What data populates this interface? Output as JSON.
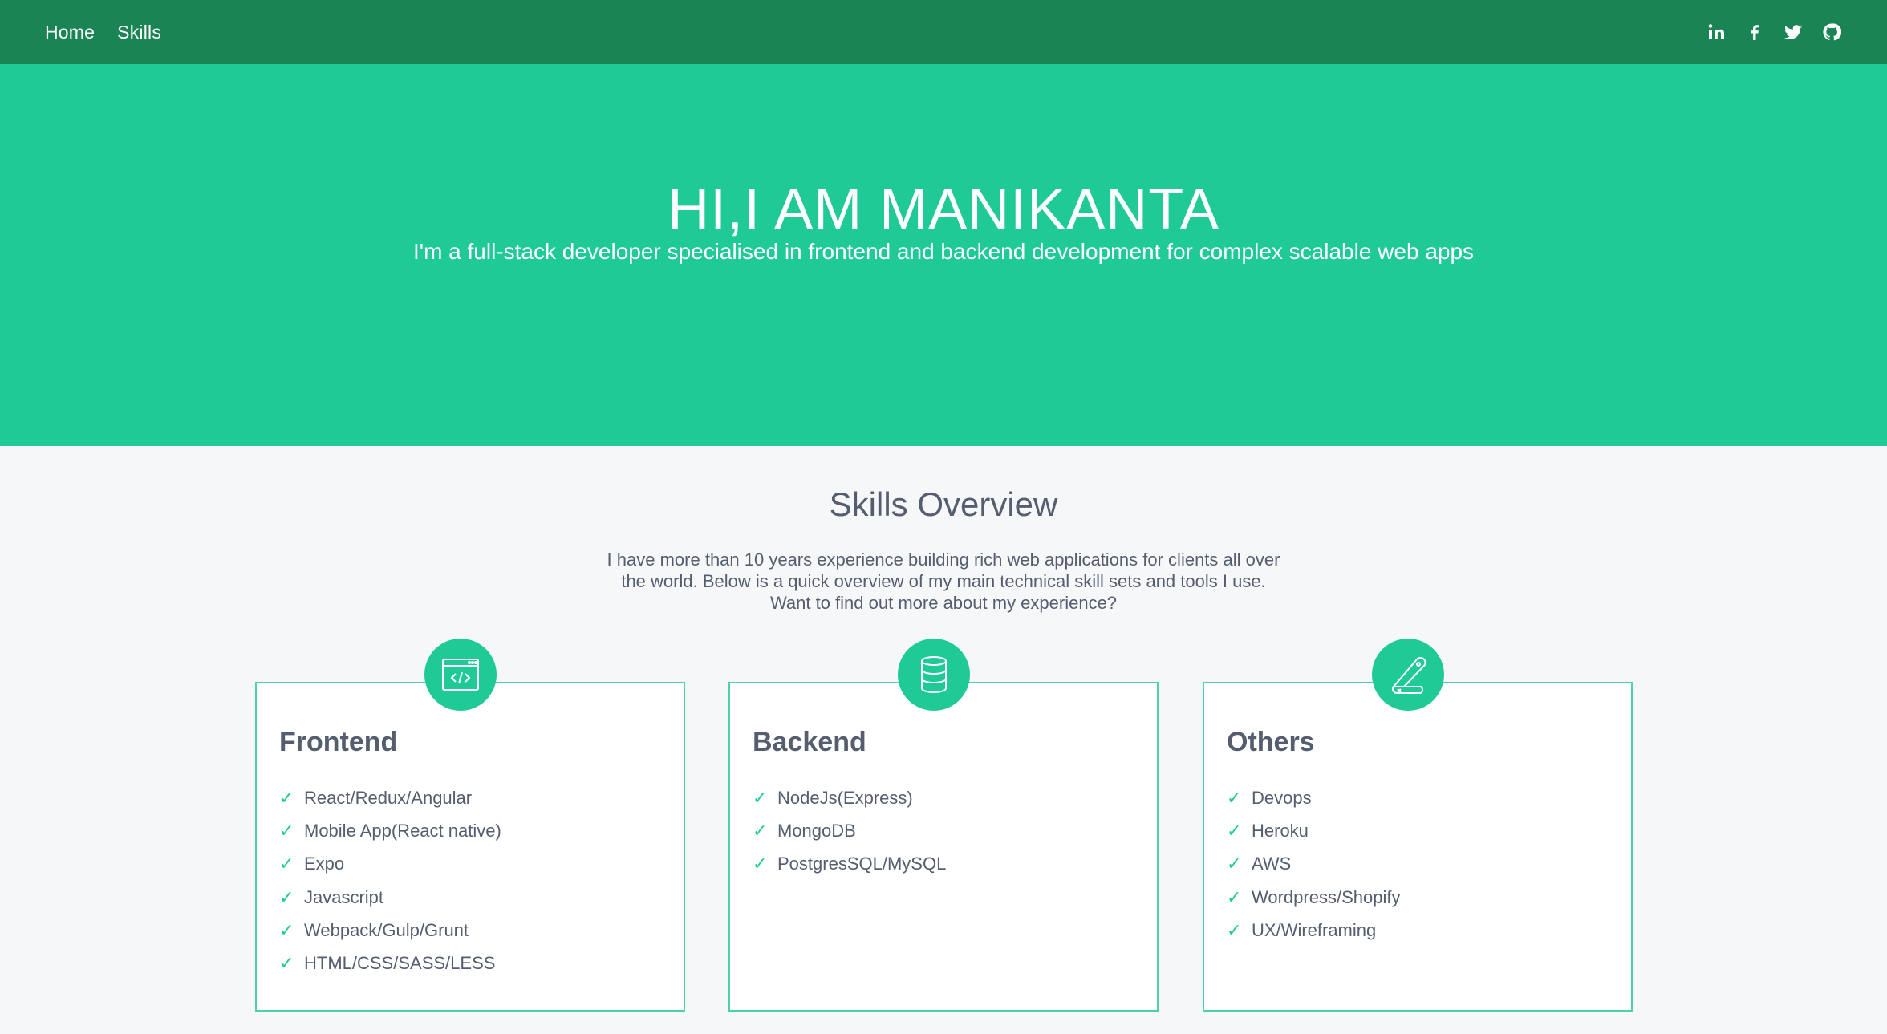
{
  "nav": {
    "links": [
      "Home",
      "Skills"
    ],
    "social": [
      "linkedin-icon",
      "facebook-icon",
      "twitter-icon",
      "github-icon"
    ]
  },
  "hero": {
    "title": "HI,I AM MANIKANTA",
    "subtitle": "I'm a full-stack developer specialised in frontend and backend development for complex scalable web apps"
  },
  "skills": {
    "title": "Skills Overview",
    "intro": "I have more than 10 years experience building rich web applications for clients all over the world. Below is a quick overview of my main technical skill sets and tools I use. Want to find out more about my experience?",
    "cards": [
      {
        "title": "Frontend",
        "icon": "code-window-icon",
        "items": [
          "React/Redux/Angular",
          "Mobile App(React native)",
          "Expo",
          "Javascript",
          "Webpack/Gulp/Grunt",
          "HTML/CSS/SASS/LESS"
        ]
      },
      {
        "title": "Backend",
        "icon": "database-icon",
        "items": [
          "NodeJs(Express)",
          "MongoDB",
          "PostgresSQL/MySQL"
        ]
      },
      {
        "title": "Others",
        "icon": "swiss-knife-icon",
        "items": [
          "Devops",
          "Heroku",
          "AWS",
          "Wordpress/Shopify",
          "UX/Wireframing"
        ]
      }
    ]
  },
  "colors": {
    "navbar": "#1a8454",
    "hero": "#1fca97",
    "text": "#545e6f",
    "card_border": "#4fcfaa"
  }
}
